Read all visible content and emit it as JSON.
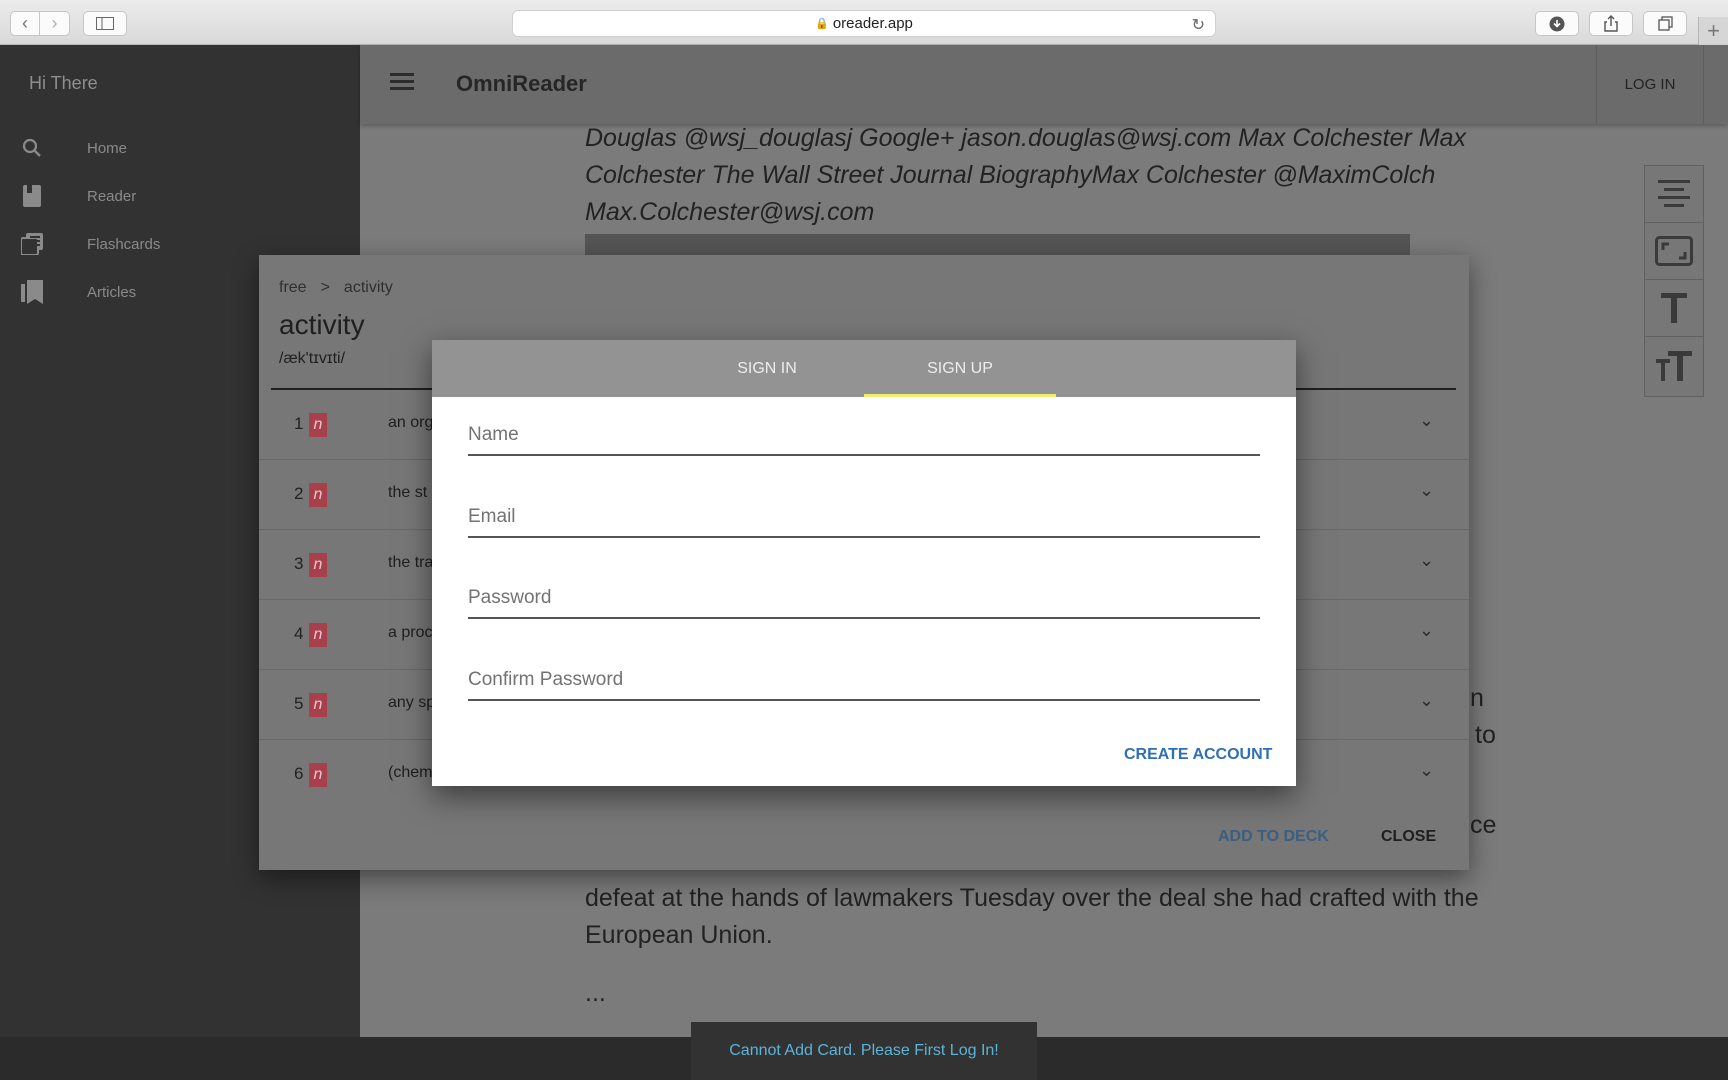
{
  "browser": {
    "url": "oreader.app"
  },
  "sidebar": {
    "greeting": "Hi There",
    "items": [
      {
        "label": "Home",
        "icon": "search-icon"
      },
      {
        "label": "Reader",
        "icon": "book-icon"
      },
      {
        "label": "Flashcards",
        "icon": "cards-icon"
      },
      {
        "label": "Articles",
        "icon": "bookmark-icon"
      }
    ]
  },
  "header": {
    "title": "OmniReader",
    "login_label": "LOG IN"
  },
  "article": {
    "byline": "Douglas @wsj_douglasj Google+ jason.douglas@wsj.com Max Colchester Max Colchester The Wall Street Journal BiographyMax Colchester @MaximColch Max.Colchester@wsj.com",
    "frag1": "n",
    "frag2": "to",
    "frag3": "ce",
    "para_end": "defeat at the hands of lawmakers Tuesday over the deal she had crafted with the European Union.",
    "ellipsis": "..."
  },
  "dictionary": {
    "breadcrumb": [
      "free",
      ">",
      "activity"
    ],
    "word": "activity",
    "phonetic": "/æk'tɪvɪti/",
    "senses": [
      {
        "num": "1",
        "pos": "n",
        "def": "an org"
      },
      {
        "num": "2",
        "pos": "n",
        "def": "the st"
      },
      {
        "num": "3",
        "pos": "n",
        "def": "the tra"
      },
      {
        "num": "4",
        "pos": "n",
        "def": "a proc"
      },
      {
        "num": "5",
        "pos": "n",
        "def": "any sp"
      },
      {
        "num": "6",
        "pos": "n",
        "def": "(chem"
      }
    ],
    "add_to_deck": "ADD TO DECK",
    "close": "CLOSE"
  },
  "auth": {
    "tabs": [
      "SIGN IN",
      "SIGN UP"
    ],
    "active_tab": "SIGN UP",
    "fields": [
      {
        "placeholder": "Name",
        "value": ""
      },
      {
        "placeholder": "Email",
        "value": ""
      },
      {
        "placeholder": "Password",
        "value": ""
      },
      {
        "placeholder": "Confirm Password",
        "value": ""
      }
    ],
    "submit": "CREATE ACCOUNT"
  },
  "toast": {
    "message": "Cannot Add Card. Please First Log In!"
  },
  "colors": {
    "accent_tab": "#f1ec6f",
    "pos_badge": "#a8404b",
    "link_blue": "#2e6fb5",
    "toast_text": "#5ab4d8"
  }
}
